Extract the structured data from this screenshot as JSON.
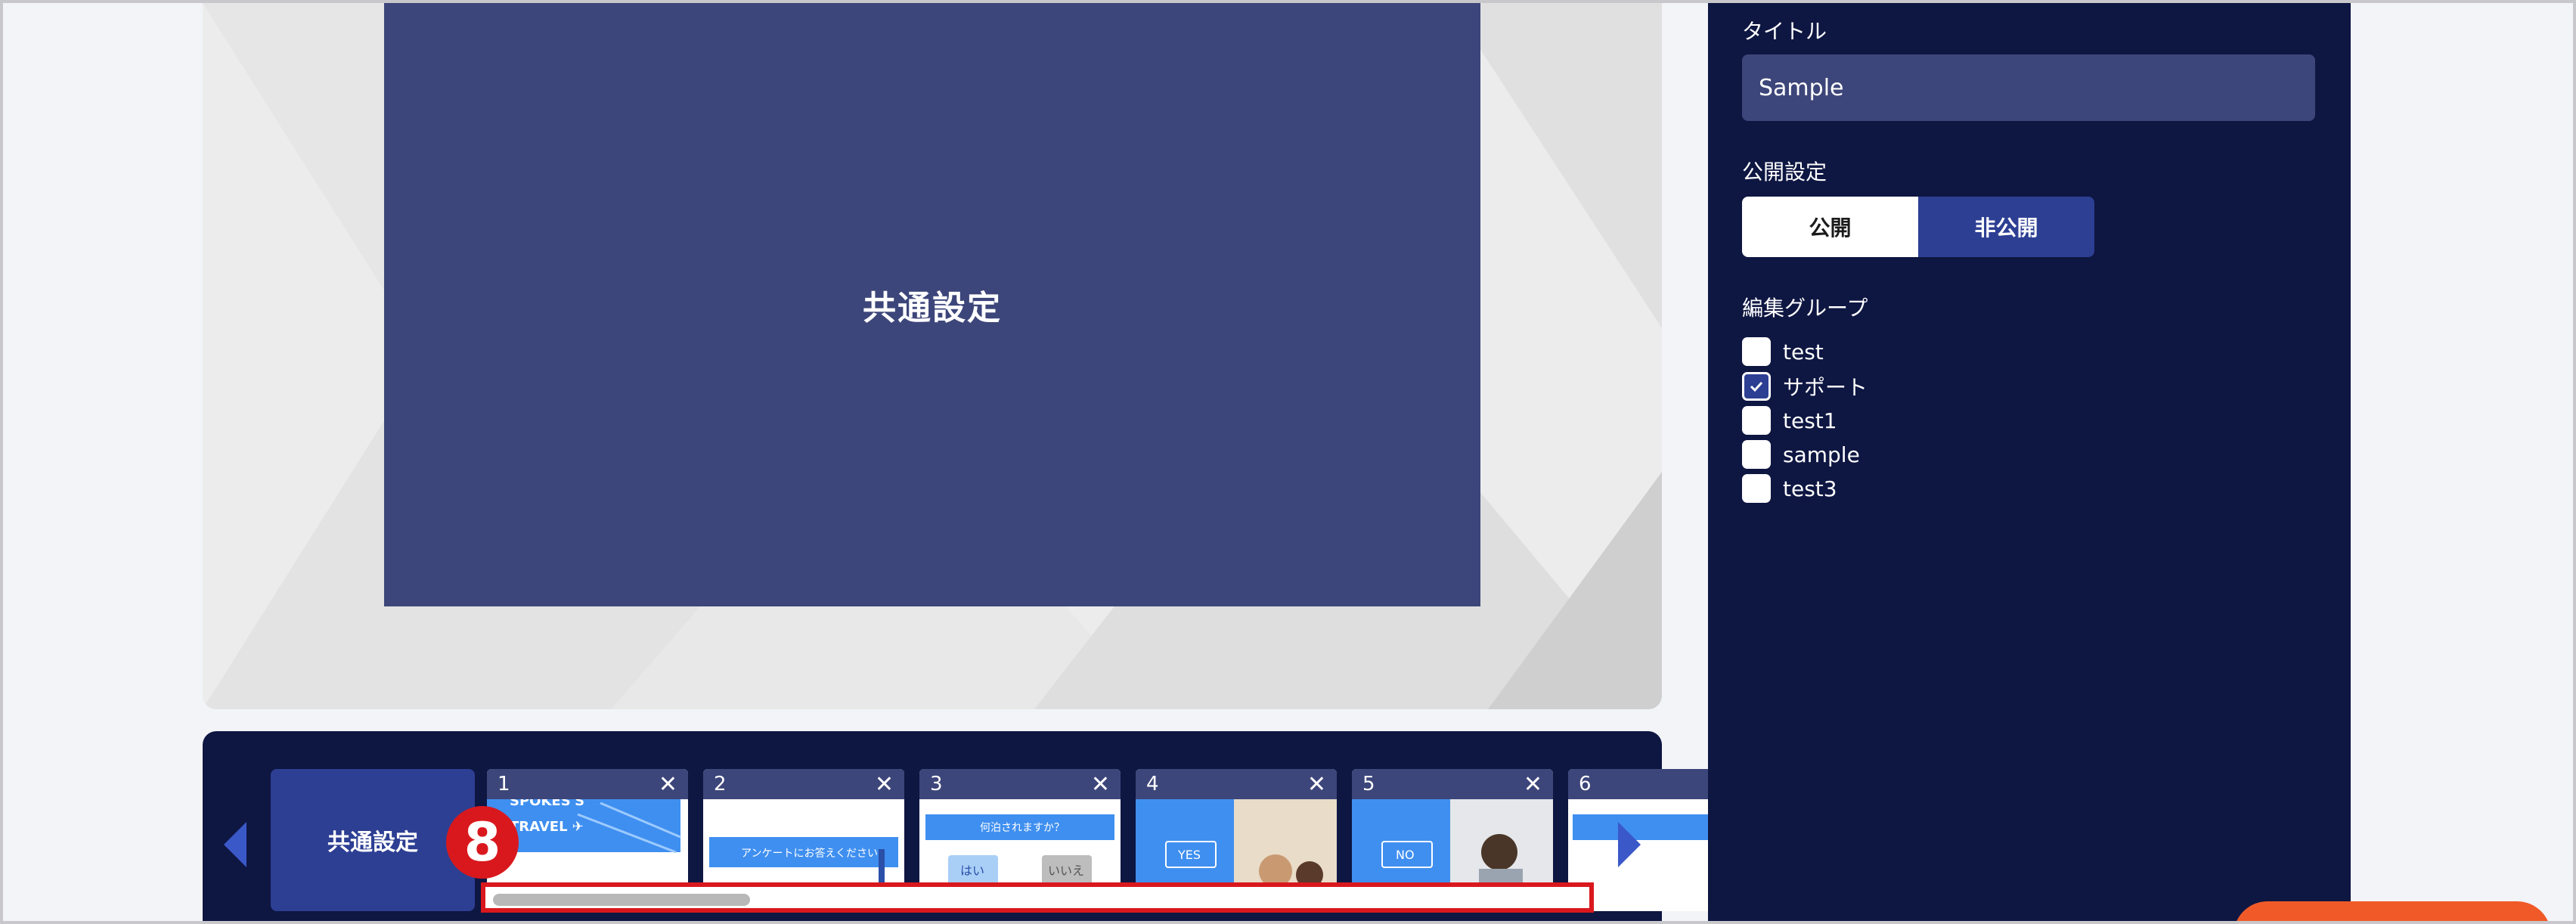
{
  "preview": {
    "title": "共通設定"
  },
  "strip": {
    "common_label": "共通設定",
    "thumbnails": [
      {
        "num": "1",
        "caption": "SPOKES'S TRAVEL"
      },
      {
        "num": "2",
        "caption": "アンケートにお答えください"
      },
      {
        "num": "3",
        "caption": "何泊されますか？",
        "yes": "はい",
        "no": "いいえ"
      },
      {
        "num": "4",
        "caption": "YES"
      },
      {
        "num": "5",
        "caption": "NO"
      },
      {
        "num": "6"
      }
    ],
    "close_glyph": "✕",
    "step_badge": "8"
  },
  "panel": {
    "title_label": "タイトル",
    "title_value": "Sample",
    "visibility_label": "公開設定",
    "visibility_options": [
      "公開",
      "非公開"
    ],
    "visibility_selected": "公開",
    "group_label": "編集グループ",
    "groups": [
      {
        "label": "test",
        "checked": false
      },
      {
        "label": "サポート",
        "checked": true
      },
      {
        "label": "test1",
        "checked": false
      },
      {
        "label": "sample",
        "checked": false
      },
      {
        "label": "test3",
        "checked": false
      }
    ]
  },
  "colors": {
    "panel_bg": "#0e1642",
    "accent": "#2d3f93",
    "preview_bg": "#3d467a",
    "highlight": "#d9181e",
    "orange": "#f05a28"
  }
}
